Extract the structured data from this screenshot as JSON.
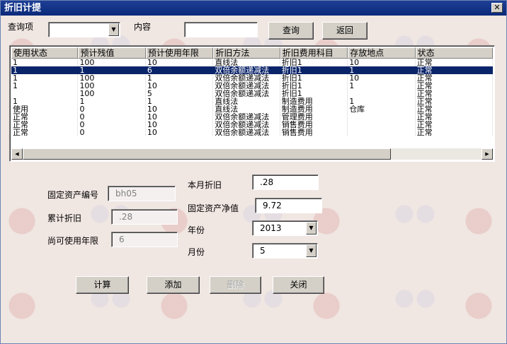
{
  "window": {
    "title": "折旧计提",
    "close_glyph": "✕"
  },
  "search": {
    "field_label": "查询项",
    "field_value": "",
    "content_label": "内容",
    "content_value": "",
    "query_button": "查询",
    "back_button": "返回"
  },
  "grid": {
    "columns": [
      "使用状态",
      "预计残值",
      "预计使用年限",
      "折旧方法",
      "折旧费用科目",
      "存放地点",
      "状态"
    ],
    "rows": [
      [
        "1",
        "100",
        "10",
        "直线法",
        "折旧1",
        "10",
        "正常"
      ],
      [
        "1",
        "1",
        "6",
        "双倍余额递减法",
        "折旧1",
        "1",
        "正常"
      ],
      [
        "1",
        "100",
        "1",
        "双倍余额递减法",
        "折旧1",
        "10",
        "正常"
      ],
      [
        "1",
        "100",
        "10",
        "双倍余额递减法",
        "折旧1",
        "1",
        "正常"
      ],
      [
        "",
        "100",
        "5",
        "双倍余额递减法",
        "折旧1",
        "",
        "正常"
      ],
      [
        "1",
        "1",
        "1",
        "直线法",
        "制造费用",
        "1",
        "正常"
      ],
      [
        "使用",
        "0",
        "10",
        "直线法",
        "制造费用",
        "仓库",
        "正常"
      ],
      [
        "正常",
        "0",
        "10",
        "双倍余额递减法",
        "管理费用",
        "",
        "正常"
      ],
      [
        "正常",
        "0",
        "10",
        "双倍余额递减法",
        "销售费用",
        "",
        "正常"
      ],
      [
        "正常",
        "0",
        "10",
        "双倍余额递减法",
        "销售费用",
        "",
        "正常"
      ]
    ],
    "selected_row": 1
  },
  "form": {
    "asset_no_label": "固定资产编号",
    "asset_no_value": "bh05",
    "accum_dep_label": "累计折旧",
    "accum_dep_value": ".28",
    "remaining_years_label": "尚可使用年限",
    "remaining_years_value": "6",
    "month_dep_label": "本月折旧",
    "month_dep_value": ".28",
    "net_value_label": "固定资产净值",
    "net_value_value": "9.72",
    "year_label": "年份",
    "year_value": "2013",
    "month_label": "月份",
    "month_value": "5"
  },
  "actions": {
    "calc_button": "计算",
    "add_button": "添加",
    "delete_button": "删除",
    "close_button": "关闭"
  },
  "colors": {
    "title_bar": "#0b2a7a",
    "selection": "#0a246a",
    "window_bg": "#f0e6e2"
  }
}
